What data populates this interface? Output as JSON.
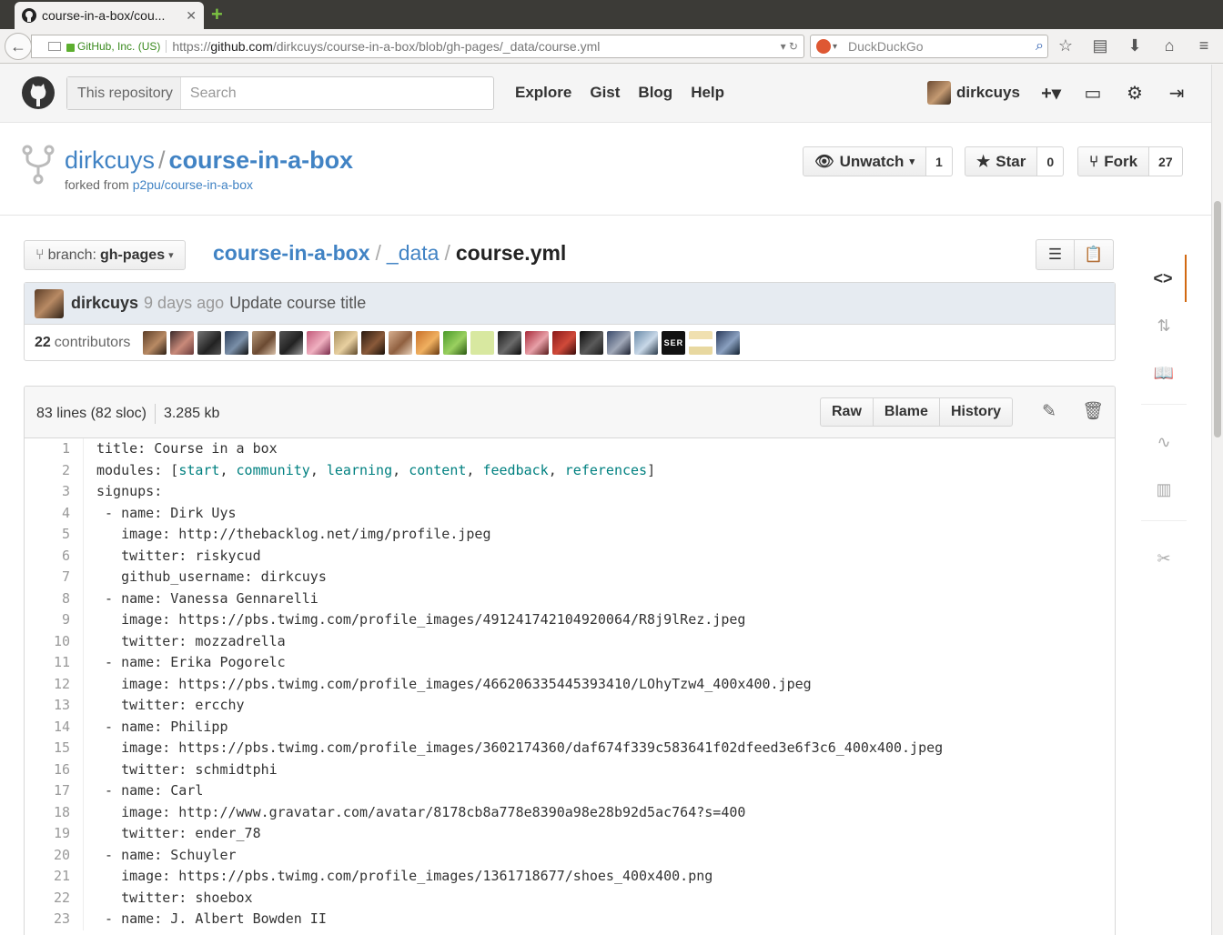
{
  "browser": {
    "tab_title": "course-in-a-box/cou...",
    "tab_close": "✕",
    "new_tab": "+",
    "identity": "GitHub, Inc. (US)",
    "url_prefix": "https://",
    "url_domain": "github.com",
    "url_path": "/dirkcuys/course-in-a-box/blob/gh-pages/_data/course.yml",
    "search_engine": "DuckDuckGo"
  },
  "github_header": {
    "search_scope": "This repository",
    "search_placeholder": "Search",
    "nav": [
      "Explore",
      "Gist",
      "Blog",
      "Help"
    ],
    "username": "dirkcuys"
  },
  "repo": {
    "owner": "dirkcuys",
    "separator": "/",
    "name": "course-in-a-box",
    "forked_from_label": "forked from",
    "forked_from": "p2pu/course-in-a-box",
    "unwatch_label": "Unwatch",
    "watch_count": "1",
    "star_label": "Star",
    "star_count": "0",
    "fork_label": "Fork",
    "fork_count": "27"
  },
  "file_nav": {
    "branch_label": "branch:",
    "branch_name": "gh-pages",
    "crumb_root": "course-in-a-box",
    "crumb_dir": "_data",
    "crumb_file": "course.yml",
    "sep": "/"
  },
  "commit": {
    "author": "dirkcuys",
    "time": "9 days ago",
    "message": "Update course title",
    "contributors_count": "22",
    "contributors_label": "contributors"
  },
  "file": {
    "lines_info": "83 lines (82 sloc)",
    "size": "3.285 kb",
    "raw": "Raw",
    "blame": "Blame",
    "history": "History"
  },
  "code_lines": [
    "title: Course in a box",
    "modules: [start, community, learning, content, feedback, references]",
    "signups:",
    " - name: Dirk Uys",
    "   image: http://thebacklog.net/img/profile.jpeg",
    "   twitter: riskycud",
    "   github_username: dirkcuys",
    " - name: Vanessa Gennarelli",
    "   image: https://pbs.twimg.com/profile_images/491241742104920064/R8j9lRez.jpeg",
    "   twitter: mozzadrella",
    " - name: Erika Pogorelc",
    "   image: https://pbs.twimg.com/profile_images/466206335445393410/LOhyTzw4_400x400.jpeg",
    "   twitter: ercchy",
    " - name: Philipp",
    "   image: https://pbs.twimg.com/profile_images/3602174360/daf674f339c583641f02dfeed3e6f3c6_400x400.jpeg",
    "   twitter: schmidtphi",
    " - name: Carl",
    "   image: http://www.gravatar.com/avatar/8178cb8a778e8390a98e28b92d5ac764?s=400",
    "   twitter: ender_78",
    " - name: Schuyler",
    "   image: https://pbs.twimg.com/profile_images/1361718677/shoes_400x400.png",
    "   twitter: shoebox",
    " - name: J. Albert Bowden II"
  ],
  "icons": {
    "github_mark": "github-octocat-icon",
    "plus": "plus-icon",
    "inbox": "inbox-icon",
    "settings": "gear-icon",
    "signout": "sign-out-icon"
  },
  "colors": {
    "link": "#4183c4",
    "active_tab_accent": "#d26911",
    "commit_bg": "#e6ebf1"
  }
}
